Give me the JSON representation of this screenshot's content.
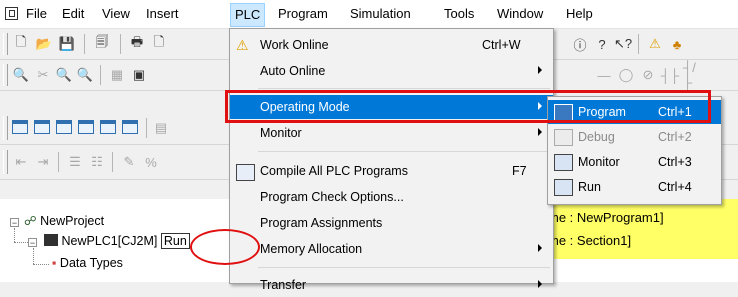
{
  "menubar": {
    "items": [
      "File",
      "Edit",
      "View",
      "Insert",
      "PLC",
      "Program",
      "Simulation",
      "Tools",
      "Window",
      "Help"
    ],
    "active": "PLC"
  },
  "plc_menu": {
    "items": [
      {
        "label": "Work Online",
        "shortcut": "Ctrl+W",
        "icon": "warning-icon"
      },
      {
        "label": "Auto Online",
        "submenu": true
      },
      {
        "label": "Operating Mode",
        "submenu": true,
        "highlighted": true
      },
      {
        "label": "Monitor",
        "submenu": true
      },
      {
        "label": "Compile All PLC Programs",
        "shortcut": "F7",
        "icon": "compile-icon"
      },
      {
        "label": "Program Check Options..."
      },
      {
        "label": "Program Assignments"
      },
      {
        "label": "Memory Allocation",
        "submenu": true
      },
      {
        "label": "Transfer",
        "submenu": true
      }
    ]
  },
  "mode_submenu": {
    "items": [
      {
        "label": "Program",
        "shortcut": "Ctrl+1",
        "highlighted": true
      },
      {
        "label": "Debug",
        "shortcut": "Ctrl+2",
        "disabled": true
      },
      {
        "label": "Monitor",
        "shortcut": "Ctrl+3"
      },
      {
        "label": "Run",
        "shortcut": "Ctrl+4"
      }
    ]
  },
  "tree": {
    "root": "NewProject",
    "plc": "NewPLC1[CJ2M]",
    "plc_mode": "Run",
    "child": "Data Types"
  },
  "section_pane": {
    "line1": "me : NewProgram1]",
    "line2": "me : Section1]"
  },
  "colors": {
    "highlight": "#0078d7",
    "annotation": "#e01010",
    "section_bg": "#ffff66"
  }
}
